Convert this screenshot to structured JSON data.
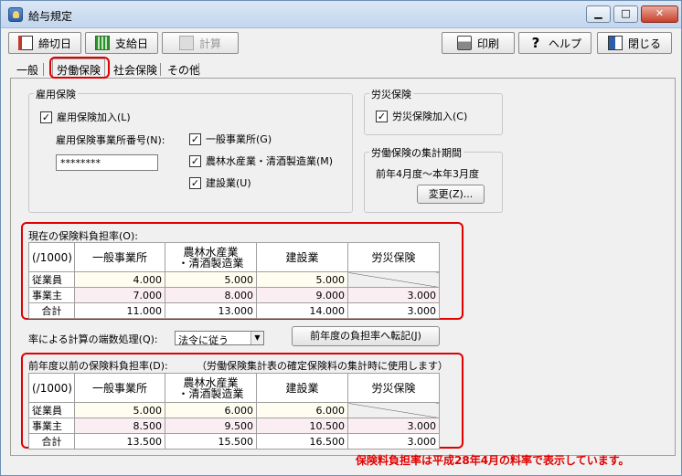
{
  "window": {
    "title": "給与規定"
  },
  "toolbar": {
    "shime": "締切日",
    "shikyu": "支給日",
    "keisan": "計算",
    "insatsu": "印刷",
    "help": "ヘルプ",
    "close": "閉じる"
  },
  "tabs": [
    "一般",
    "労働保険",
    "社会保険",
    "その他"
  ],
  "koyo": {
    "title": "雇用保険",
    "join_label": "雇用保険加入(L)",
    "office_no_label": "雇用保険事業所番号(N):",
    "office_no_value": "********",
    "general": "一般事業所(G)",
    "agri": "農林水産業・清酒製造業(M)",
    "construct": "建設業(U)"
  },
  "rosai": {
    "title": "労災保険",
    "join_label": "労災保険加入(C)"
  },
  "period": {
    "title": "労働保険の集計期間",
    "value": "前年4月度～本年3月度",
    "change_btn": "変更(Z)..."
  },
  "current": {
    "title": "現在の保険料負担率(O):",
    "headers": [
      "(/1000)",
      "一般事業所",
      "農林水産業\n・清酒製造業",
      "建設業",
      "労災保険"
    ],
    "rows": [
      {
        "label": "従業員",
        "v": [
          "4.000",
          "5.000",
          "5.000",
          ""
        ]
      },
      {
        "label": "事業主",
        "v": [
          "7.000",
          "8.000",
          "9.000",
          "3.000"
        ]
      },
      {
        "label": "合計",
        "v": [
          "11.000",
          "13.000",
          "14.000",
          "3.000"
        ]
      }
    ]
  },
  "rounding": {
    "label": "率による計算の端数処理(Q):",
    "value": "法令に従う",
    "transfer_btn": "前年度の負担率へ転記(J)"
  },
  "previous": {
    "title": "前年度以前の保険料負担率(D):",
    "note": "（労働保険集計表の確定保険料の集計時に使用します）",
    "headers": [
      "(/1000)",
      "一般事業所",
      "農林水産業\n・清酒製造業",
      "建設業",
      "労災保険"
    ],
    "rows": [
      {
        "label": "従業員",
        "v": [
          "5.000",
          "6.000",
          "6.000",
          ""
        ]
      },
      {
        "label": "事業主",
        "v": [
          "8.500",
          "9.500",
          "10.500",
          "3.000"
        ]
      },
      {
        "label": "合計",
        "v": [
          "13.500",
          "15.500",
          "16.500",
          "3.000"
        ]
      }
    ]
  },
  "footnote": "保険料負担率は平成28年4月の料率で表示しています。"
}
